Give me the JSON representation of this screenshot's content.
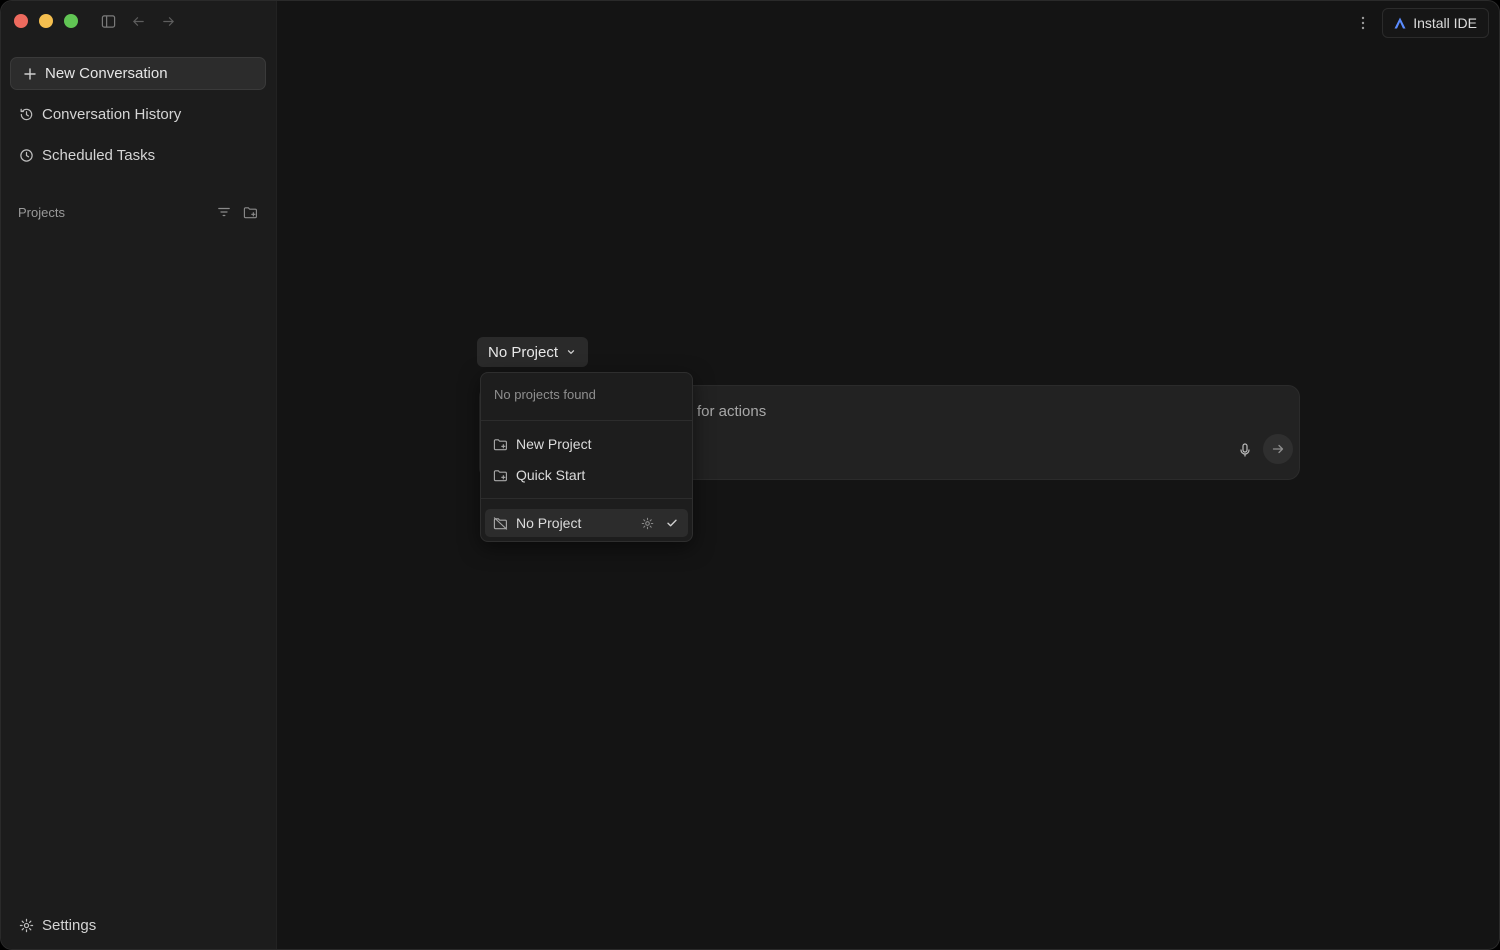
{
  "window": {
    "traffic_lights": [
      "close",
      "minimize",
      "maximize"
    ]
  },
  "toolbar": {
    "icons": [
      "sidebar-toggle-icon",
      "back-arrow-icon",
      "forward-arrow-icon"
    ]
  },
  "sidebar": {
    "new_conversation_label": "New Conversation",
    "items": [
      {
        "label": "Conversation History",
        "icon": "history-icon"
      },
      {
        "label": "Scheduled Tasks",
        "icon": "clock-icon"
      }
    ],
    "projects_label": "Projects",
    "projects_tools": [
      "filter-icon",
      "new-folder-icon"
    ],
    "settings_label": "Settings"
  },
  "header": {
    "install_ide_label": "Install IDE"
  },
  "main": {
    "project_select_label": "No Project",
    "composer_placeholder_fragment": "for actions"
  },
  "dropdown": {
    "empty_message": "No projects found",
    "actions": [
      {
        "label": "New Project",
        "icon": "folder-plus-icon"
      },
      {
        "label": "Quick Start",
        "icon": "folder-plus-icon"
      }
    ],
    "selected_item": {
      "label": "No Project",
      "icon": "folder-off-icon"
    }
  },
  "colors": {
    "window_bg": "#141414",
    "sidebar_bg": "#1c1c1c",
    "close": "#ed6a5e",
    "minimize": "#f5bf4f",
    "maximize": "#61c554",
    "ide_logo": "#5b8cff"
  }
}
